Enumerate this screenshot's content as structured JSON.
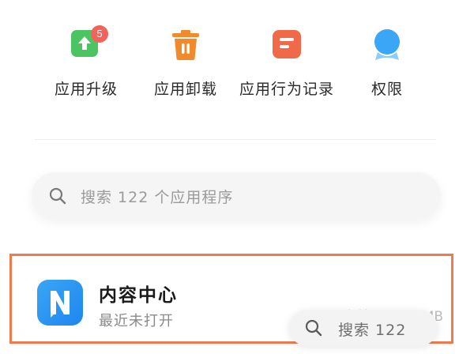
{
  "quick_actions": [
    {
      "label": "应用升级",
      "icon": "upgrade-arrow-icon",
      "badge": "5",
      "color": "#4cc461"
    },
    {
      "label": "应用卸载",
      "icon": "trash-icon",
      "color": "#f08a2a"
    },
    {
      "label": "应用行为记录",
      "icon": "record-icon",
      "color": "#f06a4a"
    },
    {
      "label": "权限",
      "icon": "permission-icon",
      "color": "#3aa6f5"
    }
  ],
  "search": {
    "placeholder": "搜索 122 个应用程序"
  },
  "app": {
    "name": "内容中心",
    "status": "最近未打开",
    "storage": "存储：33.22MB",
    "icon": "content-center-icon",
    "highlight_color": "#f07a4e"
  },
  "floating_search": {
    "text": "搜索 122"
  }
}
